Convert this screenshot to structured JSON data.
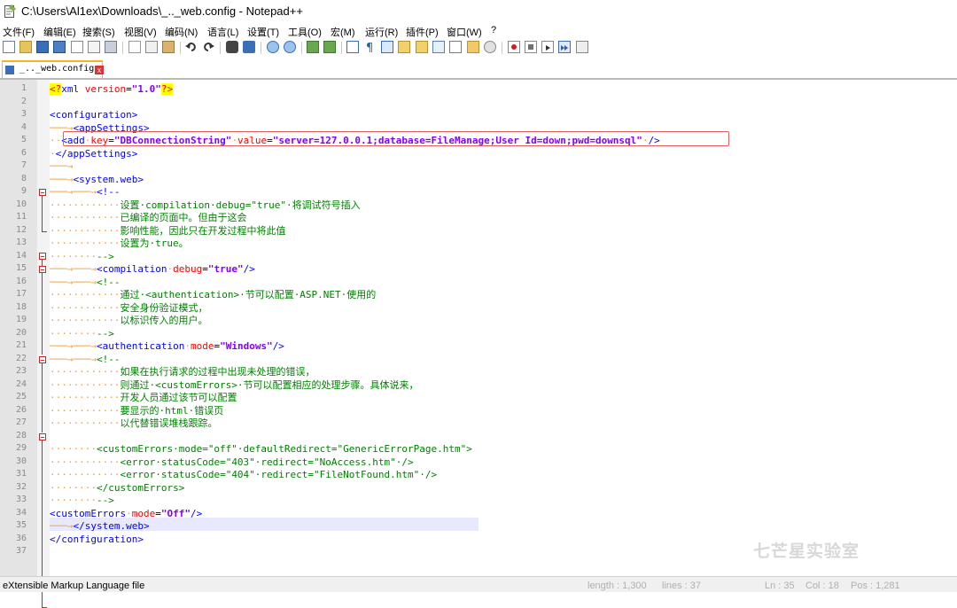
{
  "window": {
    "title": "C:\\Users\\Al1ex\\Downloads\\_.._web.config - Notepad++"
  },
  "menu": [
    "文件(F)",
    "编辑(E)",
    "搜索(S)",
    "视图(V)",
    "编码(N)",
    "语言(L)",
    "设置(T)",
    "工具(O)",
    "宏(M)",
    "运行(R)",
    "插件(P)",
    "窗口(W)",
    "?"
  ],
  "tab": {
    "label": "_.._web.config",
    "close_glyph": "x"
  },
  "editor": {
    "line_numbers": [
      "1",
      "2",
      "3",
      "4",
      "5",
      "6",
      "7",
      "8",
      "9",
      "10",
      "11",
      "12",
      "13",
      "14",
      "15",
      "16",
      "17",
      "18",
      "19",
      "20",
      "21",
      "22",
      "23",
      "24",
      "25",
      "26",
      "27",
      "28",
      "29",
      "30",
      "31",
      "32",
      "33",
      "34",
      "35",
      "36",
      "37"
    ],
    "lines": [
      [
        {
          "c": "pi",
          "t": "<?"
        },
        {
          "c": "tag",
          "t": "xml"
        },
        {
          "c": "ws",
          "t": " "
        },
        {
          "c": "attr",
          "t": "version"
        },
        {
          "c": "text",
          "t": "="
        },
        {
          "c": "val",
          "t": "\"1.0\""
        },
        {
          "c": "pi",
          "t": "?>"
        }
      ],
      [],
      [
        {
          "c": "tag",
          "t": "<configuration>"
        }
      ],
      [
        {
          "c": "arrow",
          "t": "───→"
        },
        {
          "c": "tag",
          "t": "<appSettings>"
        }
      ],
      [
        {
          "c": "ws",
          "t": "··"
        },
        {
          "c": "tag",
          "t": "<add"
        },
        {
          "c": "ws",
          "t": "·"
        },
        {
          "c": "attr",
          "t": "key"
        },
        {
          "c": "text",
          "t": "="
        },
        {
          "c": "val",
          "t": "\"DBConnectionString\""
        },
        {
          "c": "ws",
          "t": "·"
        },
        {
          "c": "attr",
          "t": "value"
        },
        {
          "c": "text",
          "t": "="
        },
        {
          "c": "val",
          "t": "\"server=127.0.0.1;database=FileManage;User Id=down;pwd=downsql\""
        },
        {
          "c": "ws",
          "t": "·"
        },
        {
          "c": "tag",
          "t": "/>"
        }
      ],
      [
        {
          "c": "ws",
          "t": "·"
        },
        {
          "c": "tag",
          "t": "</appSettings>"
        }
      ],
      [
        {
          "c": "arrow",
          "t": "───→"
        }
      ],
      [
        {
          "c": "arrow",
          "t": "───→"
        },
        {
          "c": "tag",
          "t": "<system.web>"
        }
      ],
      [
        {
          "c": "arrow",
          "t": "───→───→"
        },
        {
          "c": "tag",
          "t": "<!--"
        }
      ],
      [
        {
          "c": "ws",
          "t": "············"
        },
        {
          "c": "comment",
          "t": "设置·compilation·debug=\"true\"·将调试符号插入"
        }
      ],
      [
        {
          "c": "ws",
          "t": "············"
        },
        {
          "c": "comment",
          "t": "已编译的页面中。但由于这会"
        }
      ],
      [
        {
          "c": "ws",
          "t": "············"
        },
        {
          "c": "comment",
          "t": "影响性能，因此只在开发过程中将此值"
        }
      ],
      [
        {
          "c": "ws",
          "t": "············"
        },
        {
          "c": "comment",
          "t": "设置为·true。"
        }
      ],
      [
        {
          "c": "ws",
          "t": "········"
        },
        {
          "c": "comment",
          "t": "-->"
        }
      ],
      [
        {
          "c": "arrow",
          "t": "───→───→"
        },
        {
          "c": "tag",
          "t": "<compilation"
        },
        {
          "c": "ws",
          "t": "·"
        },
        {
          "c": "attr",
          "t": "debug"
        },
        {
          "c": "text",
          "t": "="
        },
        {
          "c": "val",
          "t": "\"true\""
        },
        {
          "c": "tag",
          "t": "/>"
        }
      ],
      [
        {
          "c": "arrow",
          "t": "───→───→"
        },
        {
          "c": "comment",
          "t": "<!--"
        }
      ],
      [
        {
          "c": "ws",
          "t": "············"
        },
        {
          "c": "comment",
          "t": "通过·<authentication>·节可以配置·ASP.NET·使用的"
        }
      ],
      [
        {
          "c": "ws",
          "t": "············"
        },
        {
          "c": "comment",
          "t": "安全身份验证模式，"
        }
      ],
      [
        {
          "c": "ws",
          "t": "············"
        },
        {
          "c": "comment",
          "t": "以标识传入的用户。"
        }
      ],
      [
        {
          "c": "ws",
          "t": "········"
        },
        {
          "c": "comment",
          "t": "-->"
        }
      ],
      [
        {
          "c": "arrow",
          "t": "───→───→"
        },
        {
          "c": "tag",
          "t": "<authentication"
        },
        {
          "c": "ws",
          "t": "·"
        },
        {
          "c": "attr",
          "t": "mode"
        },
        {
          "c": "text",
          "t": "="
        },
        {
          "c": "val",
          "t": "\"Windows\""
        },
        {
          "c": "tag",
          "t": "/>"
        }
      ],
      [
        {
          "c": "arrow",
          "t": "───→───→"
        },
        {
          "c": "comment",
          "t": "<!--"
        }
      ],
      [
        {
          "c": "ws",
          "t": "············"
        },
        {
          "c": "comment",
          "t": "如果在执行请求的过程中出现未处理的错误，"
        }
      ],
      [
        {
          "c": "ws",
          "t": "············"
        },
        {
          "c": "comment",
          "t": "则通过·<customErrors>·节可以配置相应的处理步骤。具体说来，"
        }
      ],
      [
        {
          "c": "ws",
          "t": "············"
        },
        {
          "c": "comment",
          "t": "开发人员通过该节可以配置"
        }
      ],
      [
        {
          "c": "ws",
          "t": "············"
        },
        {
          "c": "comment",
          "t": "要显示的·html·错误页"
        }
      ],
      [
        {
          "c": "ws",
          "t": "············"
        },
        {
          "c": "comment",
          "t": "以代替错误堆栈跟踪。"
        }
      ],
      [],
      [
        {
          "c": "ws",
          "t": "········"
        },
        {
          "c": "comment",
          "t": "<customErrors·mode=\"off\"·defaultRedirect=\"GenericErrorPage.htm\">"
        }
      ],
      [
        {
          "c": "ws",
          "t": "············"
        },
        {
          "c": "comment",
          "t": "<error·statusCode=\"403\"·redirect=\"NoAccess.htm\"·/>"
        }
      ],
      [
        {
          "c": "ws",
          "t": "············"
        },
        {
          "c": "comment",
          "t": "<error·statusCode=\"404\"·redirect=\"FileNotFound.htm\"·/>"
        }
      ],
      [
        {
          "c": "ws",
          "t": "········"
        },
        {
          "c": "comment",
          "t": "</customErrors>"
        }
      ],
      [
        {
          "c": "ws",
          "t": "········"
        },
        {
          "c": "comment",
          "t": "-->"
        }
      ],
      [
        {
          "c": "tag",
          "t": "<customErrors"
        },
        {
          "c": "ws",
          "t": "·"
        },
        {
          "c": "attr",
          "t": "mode"
        },
        {
          "c": "text",
          "t": "="
        },
        {
          "c": "val",
          "t": "\"Off\""
        },
        {
          "c": "tag",
          "t": "/>"
        }
      ],
      [
        {
          "c": "arrow",
          "t": "───→"
        },
        {
          "c": "tag",
          "t": "</system.web>"
        }
      ],
      [
        {
          "c": "tag",
          "t": "</configuration>"
        }
      ],
      []
    ]
  },
  "status": {
    "language": "eXtensible Markup Language file",
    "length": "length : 1,300",
    "lines": "lines : 37",
    "ln": "Ln : 35",
    "col": "Col : 18",
    "pos": "Pos : 1,281"
  },
  "watermark": "七芒星实验室",
  "colors": {
    "tab_accent": "#f7b125",
    "fold_marker": "#c62828",
    "highlight_line": "#e8e8ff",
    "annotation_box": "#e06060"
  }
}
